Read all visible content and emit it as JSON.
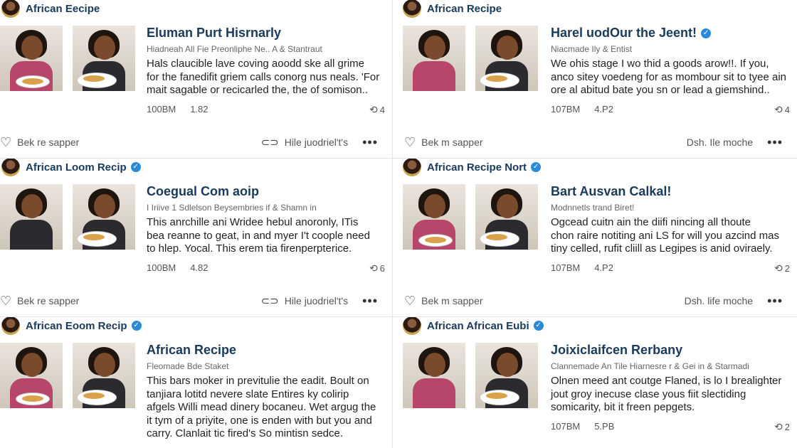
{
  "cards": [
    {
      "author": "African Eecipe",
      "verified": false,
      "title": "Eluman Purt Hisrnarly",
      "subtitle": "Hiadneah All Fie Preonliphe Ne.. A & Stantraut",
      "lines": [
        "Hals claucible lave coving aoodd ske all grime",
        "for the fanedifit griem calls conorg nus neals. 'For",
        "mait sagable or recicarled the, the of somison.."
      ],
      "stat1": "100BM",
      "stat2": "1.82",
      "share": "4",
      "action_left": "Bek re sapper",
      "action_right": "Hile juodriel't's"
    },
    {
      "author": "African Recipe",
      "verified": false,
      "title": "Harel uodOur the Jeent!",
      "title_verified": true,
      "subtitle": "Niacmade Ily & Entist",
      "lines": [
        "We ohis stage I wo thid a goods arow!!. If you,",
        "anco sitey voedeng for as mombour sit to tyee ain",
        "ore al abitud bate you sn or lead a giemshind.."
      ],
      "stat1": "107BM",
      "stat2": "4.P2",
      "share": "4",
      "action_left": "Bek m sapper",
      "action_right": "Dsh. Ile moche"
    },
    {
      "author": "African Loom Recip",
      "verified": true,
      "title": "Coegual Com aoip",
      "subtitle": "I Iriive 1 Sdlelson Beysembries if & Shamn in",
      "lines": [
        "This anrchille ani Wridee hebul anoronly, ITis",
        "bea reanne to geat, in and myer I't coople need",
        "to hlep. Yocal. This erem tia firenperpterice."
      ],
      "stat1": "100BM",
      "stat2": "4.82",
      "share": "6",
      "action_left": "Bek re sapper",
      "action_right": "Hile juodriel't's"
    },
    {
      "author": "African Recipe Nort",
      "verified": true,
      "title": "Bart Ausvan Calkal!",
      "subtitle": "Modnnetls trand Biret!",
      "lines": [
        "Ogcead cuitn ain the diifi nincing all thoute",
        "chon raire notiting ani LS for will you azcind mas",
        "tiny celled, rufit cliill as Legipes is anid oviraely."
      ],
      "stat1": "107BM",
      "stat2": "4.P2",
      "share": "2",
      "action_left": "Bek m sapper",
      "action_right": "Dsh. life moche"
    },
    {
      "author": "African Eoom Recip",
      "verified": true,
      "title": "African Recipe",
      "subtitle": "Fleomade Bde Staket",
      "lines": [
        "This bars moker in previtulie the eadit. Boult on",
        "tanjiara lotitd nevere slate Entires ky colirip",
        "afgels Willi mead dinery bocaneu. Wet argug the",
        "it tym of a priyite, one is enden with but you and",
        "carry. Clanlait tic fired's So mintisn sedce."
      ],
      "action_left": "",
      "action_right": ""
    },
    {
      "author": "African African Eubi",
      "verified": true,
      "title": "Joixiclaifcen Rerbany",
      "subtitle": "Clannemade An Tile Hiarnesre r & Gei in & Starmadi",
      "lines": [
        "Olnen meed ant coutge Flaned, is lo I brealighter",
        "jout groy inecuse clase yous fiit slectiding",
        "somicarity, bit it freen pepgets."
      ],
      "stat1": "107BM",
      "stat2": "5.PB",
      "share": "2",
      "action_left": "",
      "action_right": ""
    }
  ],
  "colors": {
    "accent": "#1a3a5c",
    "verified": "#2a8ad8"
  },
  "icons": {
    "heart": "heart-icon",
    "link": "link-icon",
    "more": "more-icon",
    "share": "share-icon"
  }
}
